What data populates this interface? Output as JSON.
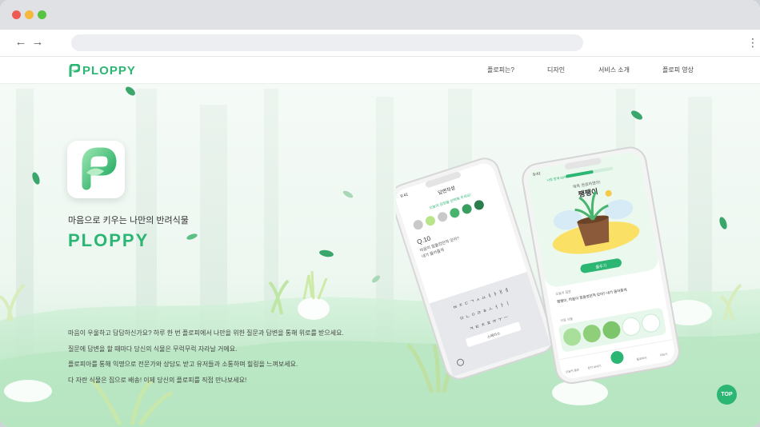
{
  "browser": {
    "back_icon": "arrow-left-icon",
    "forward_icon": "arrow-right-icon",
    "menu_icon": "kebab-menu-icon"
  },
  "header": {
    "logo_text": "PLOPPY",
    "nav": [
      "플로피는?",
      "디자인",
      "서비스 소개",
      "플로피 영상"
    ]
  },
  "hero": {
    "tagline": "마음으로 키우는 나만의 반려식물",
    "brand": "PLOPPY",
    "description": [
      "마음이 우울하고 답답하신가요? 하루 한 번 플로피에서 나만을 위한 질문과 답변을 통해 위로를 받으세요.",
      "질문에 답변을 할 때마다 당신의 식물은 무럭무럭 자라날 거에요.",
      "플로피아를 통해 익명으로 전문가와 상담도 받고 유저들과 소통하며 힐링을 느껴보세요.",
      "다 자란 식물은 집으로 배송! 이제 당신의 플로피를 직접 만나보세요!"
    ]
  },
  "phone_left": {
    "time": "9:41",
    "screen_title": "답변작성",
    "prompt": "오늘의 감정을 선택해 주세요!",
    "question_no": "Q.10",
    "question_lines": [
      "마음이 힘들었던적 있어?",
      "내가 들어줄게"
    ],
    "keyboard_rows": [
      "ㅂㅈㄷㄱㅅㅛㅕㅑㅐㅔ",
      "ㅁㄴㅇㄹㅎㅗㅓㅏㅣ",
      "ㅋㅌㅊㅍㅠㅜㅡ"
    ],
    "keyboard_space": "스페이스"
  },
  "phone_right": {
    "time": "9:41",
    "growth": "나랑 함께 58%",
    "growth_value": 0.58,
    "status": "목욕 완료하였어!",
    "plant_name": "팽팽이",
    "water_button": "물주기",
    "today_q_label": "오늘의 질문",
    "today_q": "팽팽이, 마음이 힘들었던적 있어? 내가 들어줄게",
    "plant_list_label": "키운 식물",
    "tabs": [
      "오늘의 질문",
      "편지 보내기",
      "",
      "플로피아",
      "더보기"
    ]
  },
  "top_button": "TOP",
  "colors": {
    "brand": "#2bb673",
    "accent_yellow": "#fbe066"
  }
}
